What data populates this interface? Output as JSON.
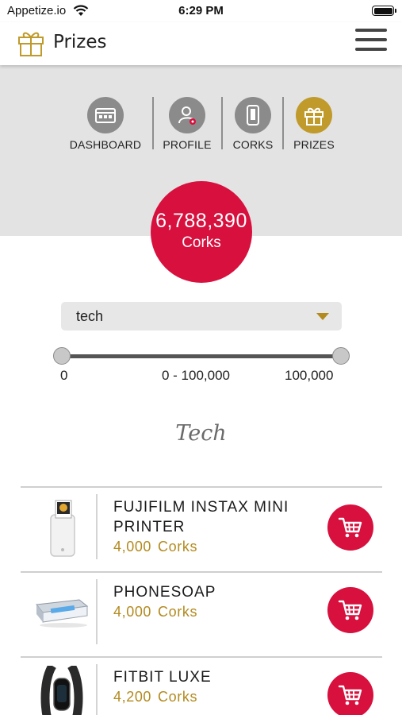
{
  "status_bar": {
    "carrier": "Appetize.io",
    "time": "6:29 PM"
  },
  "app_bar": {
    "title": "Prizes"
  },
  "nav": [
    {
      "label": "DASHBOARD",
      "icon": "dashboard-icon"
    },
    {
      "label": "PROFILE",
      "icon": "profile-icon"
    },
    {
      "label": "CORKS",
      "icon": "corks-icon"
    },
    {
      "label": "PRIZES",
      "icon": "gift-icon",
      "active": true
    }
  ],
  "balance": {
    "value": "6,788,390",
    "unit": "Corks"
  },
  "filter": {
    "category": "tech",
    "range_min": "0",
    "range_label": "0 - 100,000",
    "range_max": "100,000"
  },
  "category_title": "Tech",
  "prizes": [
    {
      "name": "FUJIFILM INSTAX MINI PRINTER",
      "price": "4,000",
      "unit": "Corks"
    },
    {
      "name": "PHONESOAP",
      "price": "4,000",
      "unit": "Corks"
    },
    {
      "name": "FITBIT LUXE",
      "price": "4,200",
      "unit": "Corks"
    }
  ],
  "colors": {
    "accent_red": "#d7103e",
    "accent_gold": "#c09a2b",
    "nav_gray": "#8b8b8b",
    "header_gray": "#e3e3e3"
  }
}
